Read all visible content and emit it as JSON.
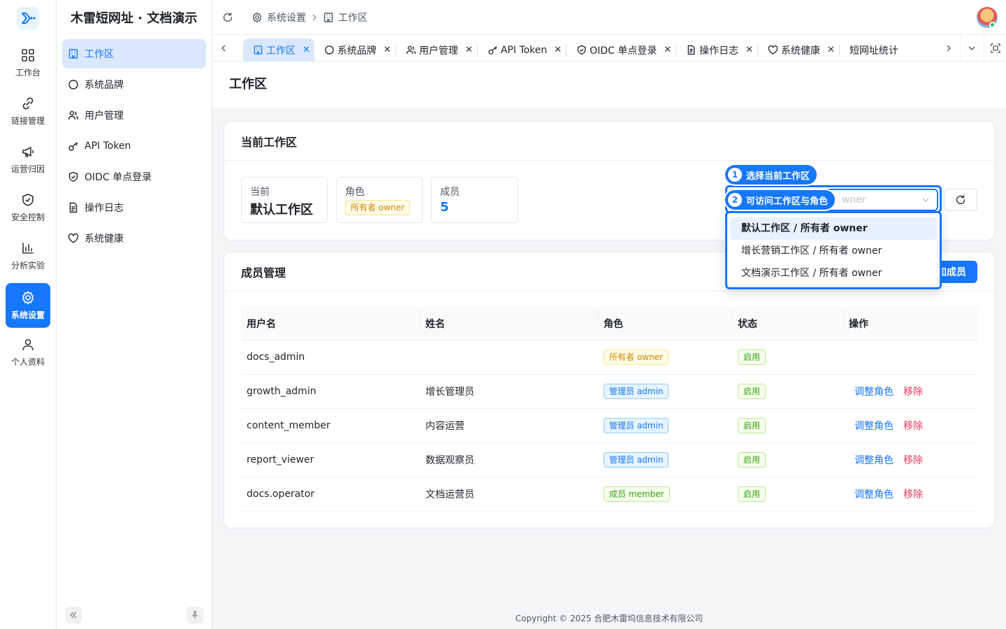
{
  "rail": {
    "items": [
      {
        "label": "工作台",
        "icon": "grid-icon"
      },
      {
        "label": "链接管理",
        "icon": "link-icon"
      },
      {
        "label": "运营归因",
        "icon": "megaphone-icon"
      },
      {
        "label": "安全控制",
        "icon": "shield-icon"
      },
      {
        "label": "分析实验",
        "icon": "bar-chart-icon"
      },
      {
        "label": "系统设置",
        "icon": "gear-icon"
      },
      {
        "label": "个人资料",
        "icon": "user-icon"
      }
    ]
  },
  "submenu": {
    "brand": "木雷短网址 · 文档演示",
    "items": [
      {
        "label": "工作区",
        "icon": "building-icon"
      },
      {
        "label": "系统品牌",
        "icon": "circle-icon"
      },
      {
        "label": "用户管理",
        "icon": "users-icon"
      },
      {
        "label": "API Token",
        "icon": "key-icon"
      },
      {
        "label": "OIDC 单点登录",
        "icon": "shield-check-icon"
      },
      {
        "label": "操作日志",
        "icon": "document-icon"
      },
      {
        "label": "系统健康",
        "icon": "heart-icon"
      }
    ]
  },
  "header": {
    "breadcrumb": [
      "系统设置",
      "工作区"
    ]
  },
  "tabs": [
    {
      "label": "工作区",
      "icon": "building-icon"
    },
    {
      "label": "系统品牌",
      "icon": "circle-icon"
    },
    {
      "label": "用户管理",
      "icon": "users-icon"
    },
    {
      "label": "API Token",
      "icon": "key-icon"
    },
    {
      "label": "OIDC 单点登录",
      "icon": "shield-check-icon"
    },
    {
      "label": "操作日志",
      "icon": "document-icon"
    },
    {
      "label": "系统健康",
      "icon": "heart-icon"
    },
    {
      "label": "短网址统计",
      "icon": ""
    }
  ],
  "page": {
    "title": "工作区"
  },
  "current_workspace": {
    "title": "当前工作区",
    "stats": {
      "current_label": "当前",
      "current_value": "默认工作区",
      "role_label": "角色",
      "role_value": "所有者 owner",
      "members_label": "成员",
      "members_value": "5"
    },
    "select_placeholder_visible": "wner"
  },
  "dropdown": {
    "options": [
      "默认工作区 / 所有者 owner",
      "增长营销工作区 / 所有者 owner",
      "文档演示工作区 / 所有者 owner"
    ],
    "selected_index": 0
  },
  "callouts": [
    {
      "num": "1",
      "text": "选择当前工作区"
    },
    {
      "num": "2",
      "text": "可访问工作区与角色"
    }
  ],
  "members": {
    "title": "成员管理",
    "add_button": "加成员",
    "columns": [
      "用户名",
      "姓名",
      "角色",
      "状态",
      "操作"
    ],
    "rows": [
      {
        "username": "docs_admin",
        "name": "",
        "role": "所有者 owner",
        "role_type": "owner",
        "status": "启用",
        "actions": []
      },
      {
        "username": "growth_admin",
        "name": "增长管理员",
        "role": "管理员 admin",
        "role_type": "admin",
        "status": "启用",
        "actions": [
          "调整角色",
          "移除"
        ]
      },
      {
        "username": "content_member",
        "name": "内容运营",
        "role": "管理员 admin",
        "role_type": "admin",
        "status": "启用",
        "actions": [
          "调整角色",
          "移除"
        ]
      },
      {
        "username": "report_viewer",
        "name": "数据观察员",
        "role": "管理员 admin",
        "role_type": "admin",
        "status": "启用",
        "actions": [
          "调整角色",
          "移除"
        ]
      },
      {
        "username": "docs.operator",
        "name": "文档运营员",
        "role": "成员 member",
        "role_type": "member",
        "status": "启用",
        "actions": [
          "调整角色",
          "移除"
        ]
      }
    ]
  },
  "footer": {
    "copyright": "Copyright © 2025 合肥木雷坞信息技术有限公司"
  },
  "colors": {
    "primary": "#1677ff",
    "danger": "#f5365c",
    "owner_tag": "#d48806",
    "success_tag": "#389e0d"
  }
}
